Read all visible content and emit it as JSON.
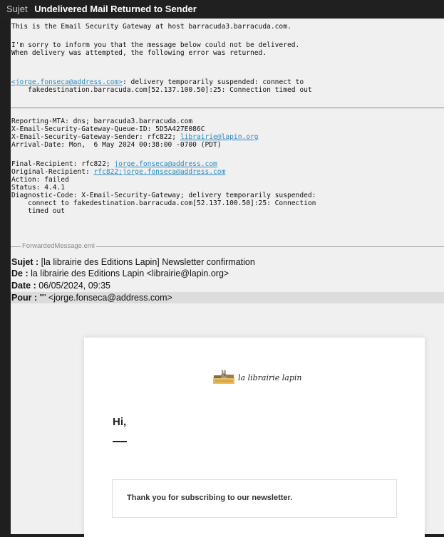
{
  "header": {
    "label": "Sujet",
    "subject": "Undelivered Mail Returned to Sender"
  },
  "intro": {
    "l1": "This is the Email Security Gateway at host barracuda3.barracuda.com.",
    "l2": "I'm sorry to inform you that the message below could not be delivered.",
    "l3": "When delivery was attempted, the following error was returned."
  },
  "error": {
    "recipient_link": "<jorge.fonseca@address.com>",
    "message": ": delivery temporarily suspended: connect to",
    "message2": "    fakedestination.barracuda.com[52.137.100.50]:25: Connection timed out"
  },
  "report": {
    "reporting_mta": "Reporting-MTA: dns; barracuda3.barracuda.com",
    "queue_id": "X-Email-Security-Gateway-Queue-ID: 5D5A427E086C",
    "sender_prefix": "X-Email-Security-Gateway-Sender: rfc822; ",
    "sender_link": "librairie@lapin.org",
    "arrival": "Arrival-Date: Mon,  6 May 2024 00:38:00 -0700 (PDT)",
    "final_prefix": "Final-Recipient: rfc822; ",
    "final_link": "jorge.fonseca@address.com",
    "original_prefix": "Original-Recipient: ",
    "original_link": "rfc822;jorge.fonseca@address.com",
    "action": "Action: failed",
    "status": "Status: 4.4.1",
    "diag1": "Diagnostic-Code: X-Email-Security-Gateway; delivery temporarily suspended:",
    "diag2": "    connect to fakedestination.barracuda.com[52.137.100.50]:25: Connection",
    "diag3": "    timed out"
  },
  "forwarded": {
    "label": "ForwardedMessage.eml",
    "subject_label": "Sujet :",
    "subject": " [la librairie des Editions Lapin] Newsletter confirmation",
    "from_label": "De :",
    "from": " la librairie des Editions Lapin <librairie@lapin.org>",
    "date_label": "Date :",
    "date": " 06/05/2024, 09:35",
    "to_label": "Pour :",
    "to": " \"\" <jorge.fonseca@address.com>"
  },
  "newsletter": {
    "logo_text": "la librairie lapin",
    "greeting": "Hi,",
    "message": "Thank you for subscribing to our newsletter."
  }
}
